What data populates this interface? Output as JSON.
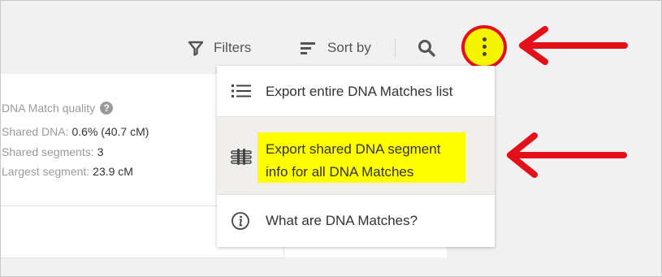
{
  "toolbar": {
    "filters_label": "Filters",
    "sort_label": "Sort by",
    "icons": [
      "funnel-icon",
      "sort-icon",
      "search-icon",
      "kebab-menu-icon"
    ]
  },
  "match_card": {
    "quality_label": "DNA Match quality",
    "help_icon": "?",
    "stats": [
      {
        "label": "Shared DNA:",
        "value": "0.6% (40.7 cM)"
      },
      {
        "label": "Shared segments:",
        "value": "3"
      },
      {
        "label": "Largest segment:",
        "value": "23.9 cM"
      }
    ]
  },
  "menu": {
    "items": [
      {
        "label": "Export entire DNA Matches list",
        "icon": "list-icon"
      },
      {
        "label_line1": "Export shared DNA segment",
        "label_line2": "info for all DNA Matches",
        "icon": "dna-segment-icon",
        "highlighted": true
      },
      {
        "label": "What are DNA Matches?",
        "icon": "info-icon"
      }
    ]
  },
  "annotations": {
    "highlight_color": "#ffff00",
    "annotation_color": "#e3101a"
  }
}
